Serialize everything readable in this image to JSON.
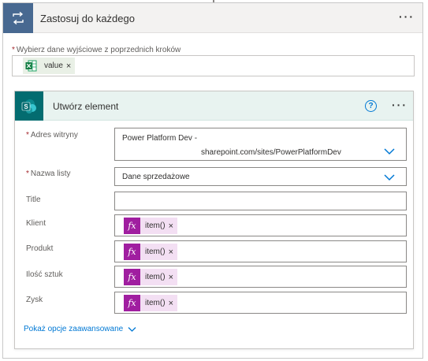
{
  "loop": {
    "title": "Zastosuj do każdego",
    "icon": "loop-icon",
    "more": "···"
  },
  "select_output": {
    "required_mark": "*",
    "label": "Wybierz dane wyjściowe z poprzednich kroków",
    "token_label": "value",
    "token_icon": "excel-icon",
    "token_close": "×"
  },
  "action": {
    "title": "Utwórz element",
    "icon": "sharepoint-icon",
    "help": "?",
    "more": "···",
    "fields": {
      "site": {
        "required_mark": "*",
        "label": "Adres witryny",
        "value_line1": "Power Platform Dev -",
        "value_line2": "sharepoint.com/sites/PowerPlatformDev"
      },
      "list": {
        "required_mark": "*",
        "label": "Nazwa listy",
        "value": "Dane sprzedażowe"
      },
      "title": {
        "label": "Title",
        "value": ""
      },
      "klient": {
        "label": "Klient",
        "expr": "item()",
        "close": "×"
      },
      "produkt": {
        "label": "Produkt",
        "expr": "item()",
        "close": "×"
      },
      "ilosc": {
        "label": "Ilość sztuk",
        "expr": "item()",
        "close": "×"
      },
      "zysk": {
        "label": "Zysk",
        "expr": "item()",
        "close": "×"
      }
    },
    "advanced_label": "Pokaż opcje zaawansowane"
  },
  "colors": {
    "loop_icon_bg": "#486991",
    "sharepoint_bg": "#036c70",
    "expression_purple": "#a01ea0",
    "link_blue": "#0078d4",
    "required_red": "#a4262c"
  }
}
